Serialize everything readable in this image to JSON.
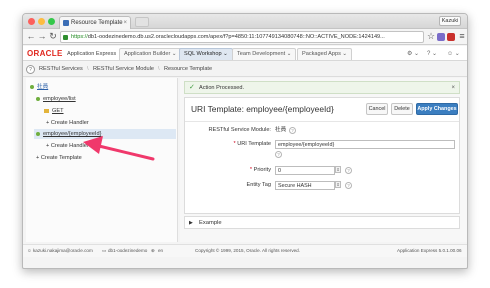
{
  "browser": {
    "tab_title": "Resource Template",
    "tab_close": "×",
    "profile": "Kazuki",
    "url_scheme": "https://",
    "url_rest": "db1-oodezinedemo.db.us2.oraclecloudapps.com/apex/f?p=4850:11:107749134080748::NO::ACTIVE_NODE:1424149...",
    "back": "←",
    "forward": "→",
    "reload": "↻",
    "star": "☆",
    "menu": "≡"
  },
  "apex": {
    "logo": "ORACLE",
    "product": "Application Express",
    "tabs": [
      {
        "label": "Application Builder ⌄"
      },
      {
        "label": "SQL Workshop ⌄"
      },
      {
        "label": "Team Development ⌄"
      },
      {
        "label": "Packaged Apps ⌄"
      }
    ],
    "tools_icon": "⚙ ⌄",
    "help_icon": "? ⌄",
    "user_icon": "☺ ⌄"
  },
  "breadcrumbs": [
    "RESTful Services",
    "RESTful Service Module",
    "Resource Template"
  ],
  "tree": {
    "root": "社員",
    "employeelist": "employee/list",
    "get": "GET",
    "create_handler_1": "Create Handler",
    "employee_id": "employee/{employeeId}",
    "create_handler_2": "Create Handler",
    "create_template": "Create Template"
  },
  "alert": {
    "message": "Action Processed.",
    "close": "×"
  },
  "form": {
    "title": "URI Template: employee/{employeeId}",
    "cancel": "Cancel",
    "delete": "Delete",
    "apply": "Apply Changes",
    "module_label": "RESTful Service Module:",
    "module_value": "社員",
    "uri_label": "URI Template",
    "uri_value": "employee/{employeeId}",
    "priority_label": "Priority",
    "priority_value": "0",
    "etag_label": "Entity Tag",
    "etag_value": "Secure HASH",
    "help": "?"
  },
  "example": {
    "label": "Example",
    "toggle": "▶"
  },
  "footer": {
    "user": "kazuki.nakajima@oracle.com",
    "workspace": "db1-oodezinedemo",
    "lang": "en",
    "copyright": "Copyright © 1999, 2015, Oracle. All rights reserved.",
    "version": "Application Express 5.0.1.00.06"
  },
  "colors": {
    "accent": "#3b7ec0",
    "oracle_red": "#e0271e",
    "success": "#3e9a3e",
    "annotation_arrow": "#f0386b"
  }
}
